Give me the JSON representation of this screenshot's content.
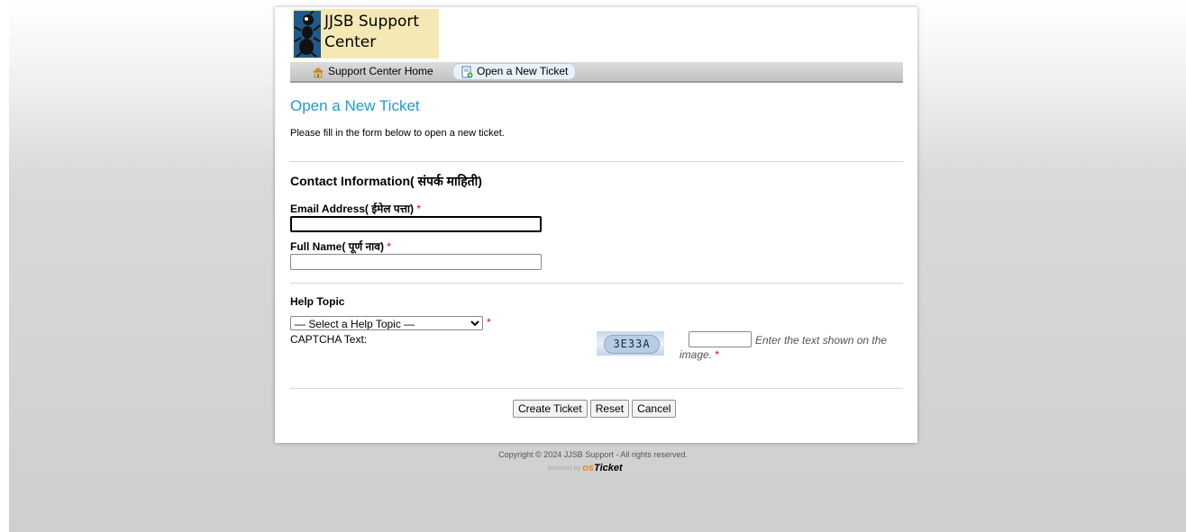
{
  "site": {
    "logo_title": "JJSB Support Center"
  },
  "nav": {
    "home_label": "Support Center Home",
    "new_ticket_label": "Open a New Ticket"
  },
  "page": {
    "title": "Open a New Ticket",
    "intro": "Please fill in the form below to open a new ticket."
  },
  "contact": {
    "section_title": "Contact Information( संपर्क माहिती)",
    "email_label": "Email Address( ईमेल पत्ता)",
    "email_value": "",
    "name_label": "Full Name( पूर्ण नाव)",
    "name_value": "",
    "required_mark": "*"
  },
  "help_topic": {
    "section_title": "Help Topic",
    "selected_option": "— Select a Help Topic —"
  },
  "captcha": {
    "label": "CAPTCHA Text:",
    "image_text": "3E33A",
    "input_value": "",
    "hint": "Enter the text shown on the image."
  },
  "actions": {
    "create_label": "Create Ticket",
    "reset_label": "Reset",
    "cancel_label": "Cancel"
  },
  "footer": {
    "copyright": "Copyright © 2024 JJSB Support - All rights reserved.",
    "powered_by": "powered by",
    "brand_os": "os",
    "brand_ticket": "Ticket"
  },
  "colors": {
    "title_blue": "#1e9bd6",
    "logo_bg": "#f4e9b4",
    "required_red": "#dd0000"
  }
}
